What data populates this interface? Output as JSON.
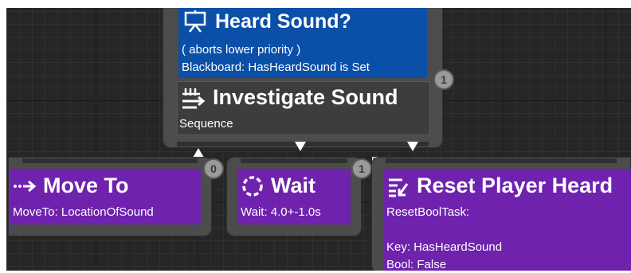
{
  "colors": {
    "decorator_blue": "#0a4fa8",
    "task_purple": "#6e22ad",
    "composite_gray": "#3d3d3d",
    "node_shell": "#4c4c4c"
  },
  "composite": {
    "decorator": {
      "icon": "display-icon",
      "title": "Heard Sound?",
      "line1": "( aborts lower priority )",
      "line2": "Blackboard: HasHeardSound is Set",
      "badge": "1"
    },
    "icon": "sequence-icon",
    "title": "Investigate Sound",
    "subtitle": "Sequence"
  },
  "tasks": {
    "move_to": {
      "icon": "move-arrow-icon",
      "title": "Move To",
      "detail": "MoveTo: LocationOfSound",
      "badge": "0"
    },
    "wait": {
      "icon": "wait-circle-icon",
      "title": "Wait",
      "detail": "Wait: 4.0+-1.0s",
      "badge": "1"
    },
    "reset": {
      "icon": "reset-bool-icon",
      "title": "Reset Player Heard",
      "line1": "ResetBoolTask:",
      "line2": "Key: HasHeardSound",
      "line3": "Bool: False"
    }
  }
}
